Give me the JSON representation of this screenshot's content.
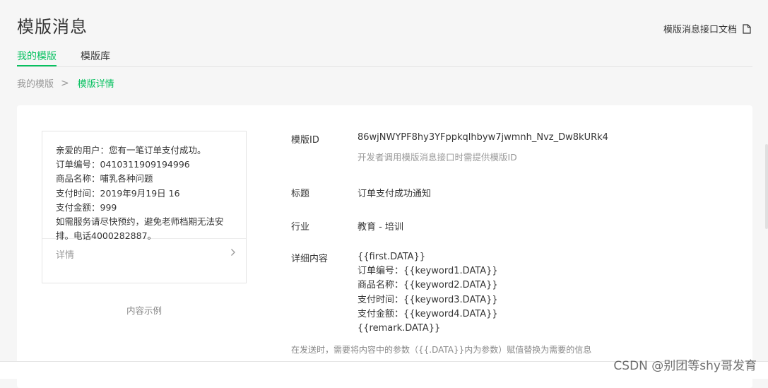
{
  "header": {
    "title": "模版消息",
    "doc_link_label": "模版消息接口文档",
    "doc_icon": "document-icon"
  },
  "tabs": [
    {
      "label": "我的模版",
      "active": true
    },
    {
      "label": "模版库",
      "active": false
    }
  ],
  "breadcrumb": {
    "first": "我的模版",
    "separator": ">",
    "current": "模版详情"
  },
  "preview": {
    "lines": [
      "亲爱的用户：您有一笔订单支付成功。",
      "订单编号：0410311909194996",
      "商品名称：哺乳各种问题",
      "支付时间：2019年9月19日 16",
      "支付金额：999",
      "如需服务请尽快预约，避免老师档期无法安排。电话4000282887。"
    ],
    "detail_label": "详情",
    "chevron_icon": "chevron-right-icon",
    "caption": "内容示例"
  },
  "info": {
    "template_id_label": "模版ID",
    "template_id_value": "86wjNWYPF8hy3YFppkqlhbyw7jwmnh_Nvz_Dw8kURk4",
    "template_id_hint": "开发者调用模版消息接口时需提供模版ID",
    "title_label": "标题",
    "title_value": "订单支付成功通知",
    "industry_label": "行业",
    "industry_value": "教育 - 培训",
    "content_label": "详细内容",
    "content_lines": [
      "{{first.DATA}}",
      "订单编号：{{keyword1.DATA}}",
      "商品名称：{{keyword2.DATA}}",
      "支付时间：{{keyword3.DATA}}",
      "支付金额：{{keyword4.DATA}}",
      "{{remark.DATA}}"
    ],
    "footer_hint": "在发送时，需要将内容中的参数（{{.DATA}}内为参数）赋值替换为需要的信息"
  },
  "watermark": "CSDN @别团等shy哥发育",
  "colors": {
    "accent": "#07c160",
    "muted": "#999999",
    "background": "#f6f6f6"
  }
}
